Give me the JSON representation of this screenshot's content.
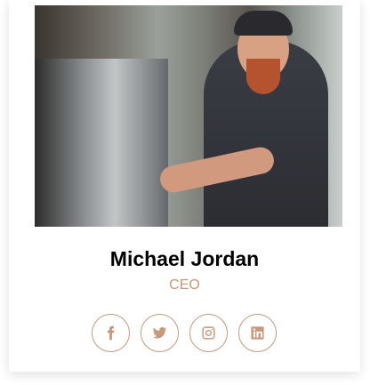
{
  "profile": {
    "name": "Michael Jordan",
    "role": "CEO"
  },
  "social": [
    {
      "icon": "facebook-icon"
    },
    {
      "icon": "twitter-icon"
    },
    {
      "icon": "instagram-icon"
    },
    {
      "icon": "linkedin-icon"
    }
  ],
  "colors": {
    "accent": "#c8987a",
    "name": "#000000"
  }
}
